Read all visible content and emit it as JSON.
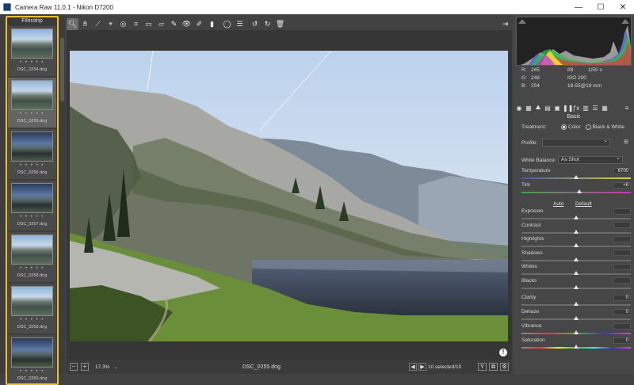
{
  "window": {
    "title": "Camera Raw 11.0.1  -  Nikon D7200",
    "min_glyph": "—",
    "max_glyph": "☐",
    "close_glyph": "✕"
  },
  "filmstrip": {
    "title": "Filmstrip",
    "rating_dots": "• • • • •",
    "items": [
      {
        "name": "DSC_0254.dng",
        "selected": false,
        "tone": "light"
      },
      {
        "name": "DSC_0255.dng",
        "selected": true,
        "tone": "light"
      },
      {
        "name": "DSC_0256.dng",
        "selected": false,
        "tone": "dark"
      },
      {
        "name": "DSC_0257.dng",
        "selected": false,
        "tone": "dark"
      },
      {
        "name": "DSC_0258.dng",
        "selected": false,
        "tone": "light"
      },
      {
        "name": "DSC_0259.dng",
        "selected": false,
        "tone": "light"
      },
      {
        "name": "DSC_0260.dng",
        "selected": false,
        "tone": "dark"
      }
    ]
  },
  "toolbar": {
    "tools": [
      {
        "name": "zoom-tool",
        "glyph": "🔍︎",
        "active": true
      },
      {
        "name": "hand-tool",
        "glyph": "✋︎",
        "active": false
      },
      {
        "name": "white-balance-tool",
        "glyph": "⟋",
        "active": false
      },
      {
        "name": "color-sampler-tool",
        "glyph": "⌖",
        "active": false
      },
      {
        "name": "targeted-adjustment-tool",
        "glyph": "◎",
        "active": false
      },
      {
        "name": "crop-tool",
        "glyph": "⌗",
        "active": false
      },
      {
        "name": "straighten-tool",
        "glyph": "▭",
        "active": false
      },
      {
        "name": "transform-tool",
        "glyph": "▱",
        "active": false
      },
      {
        "name": "spot-removal-tool",
        "glyph": "✎",
        "active": false
      },
      {
        "name": "red-eye-tool",
        "glyph": "👁︎",
        "active": false
      },
      {
        "name": "adjustment-brush-tool",
        "glyph": "✐",
        "active": false
      },
      {
        "name": "graduated-filter-tool",
        "glyph": "▮",
        "active": false
      },
      {
        "name": "radial-filter-tool",
        "glyph": "◯",
        "active": false
      },
      {
        "name": "preferences-tool",
        "glyph": "☰",
        "active": false
      },
      {
        "name": "rotate-left-tool",
        "glyph": "↺",
        "active": false
      },
      {
        "name": "rotate-right-tool",
        "glyph": "↻",
        "active": false
      },
      {
        "name": "delete-tool",
        "glyph": "🗑︎",
        "active": false
      }
    ],
    "exit_glyph": "⇥"
  },
  "canvas": {
    "warning_glyph": "!"
  },
  "statusbar": {
    "zoom_out_glyph": "−",
    "zoom_in_glyph": "+",
    "zoom": "17.3%",
    "zoom_caret": "⌄",
    "filename": "DSC_0255.dng",
    "prev_glyph": "◀",
    "next_glyph": "▶",
    "selection": "10 selected/10",
    "y_label": "Y",
    "compare_glyph": "⧉",
    "settings_glyph": "⚙"
  },
  "readout": {
    "r": "245",
    "g": "248",
    "b": "254",
    "r_label": "R:",
    "g_label": "G:",
    "b_label": "B:",
    "aperture": "f/8",
    "shutter": "1/50 s",
    "iso": "ISO 200",
    "lens": "18-55@18 mm"
  },
  "panel": {
    "name": "Basic",
    "tab_glyphs": [
      "◉",
      "▦",
      "⛰",
      "▤",
      "▣",
      "❚❚",
      "ƒx",
      "▥",
      "☰",
      "▦"
    ],
    "menu_glyph": "≡",
    "treatment_label": "Treatment:",
    "treatment_color": "Color",
    "treatment_bw": "Black & White",
    "profile_label": "Profile:",
    "profile_value": "",
    "wb_label": "White Balance:",
    "wb_value": "As Shot",
    "temperature": {
      "label": "Temperature",
      "value": "6700",
      "level": 0.5
    },
    "tint": {
      "label": "Tint",
      "value": "+8",
      "level": 0.53
    },
    "auto": "Auto",
    "default": "Default",
    "sliders": [
      {
        "label": "Exposure",
        "value": "",
        "level": 0.5
      },
      {
        "label": "Contrast",
        "value": "",
        "level": 0.5
      },
      {
        "label": "Highlights",
        "value": "",
        "level": 0.5
      },
      {
        "label": "Shadows",
        "value": "",
        "level": 0.5
      },
      {
        "label": "Whites",
        "value": "",
        "level": 0.5
      },
      {
        "label": "Blacks",
        "value": "",
        "level": 0.5
      }
    ],
    "presence": [
      {
        "label": "Clarity",
        "value": "0",
        "level": 0.5,
        "track": "plain"
      },
      {
        "label": "Dehaze",
        "value": "0",
        "level": 0.5,
        "track": "plain"
      },
      {
        "label": "Vibrance",
        "value": "",
        "level": 0.5,
        "track": "vib"
      },
      {
        "label": "Saturation",
        "value": "0",
        "level": 0.5,
        "track": "sat"
      }
    ]
  },
  "colors": {
    "filmstrip_highlight": "#f0c12c",
    "panel_bg": "#474747",
    "canvas_bg": "#363636"
  }
}
